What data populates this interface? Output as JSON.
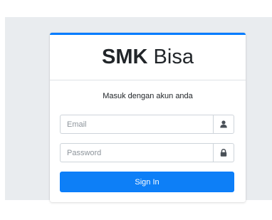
{
  "login": {
    "brand_bold": "SMK",
    "brand_light": "Bisa",
    "subtitle": "Masuk dengan akun anda",
    "email": {
      "placeholder": "Email",
      "value": "",
      "icon": "user-icon"
    },
    "password": {
      "placeholder": "Password",
      "value": "",
      "icon": "lock-icon"
    },
    "submit_label": "Sign In"
  },
  "colors": {
    "page_background": "#e9ecef",
    "accent": "#007bff",
    "text": "#212529"
  }
}
